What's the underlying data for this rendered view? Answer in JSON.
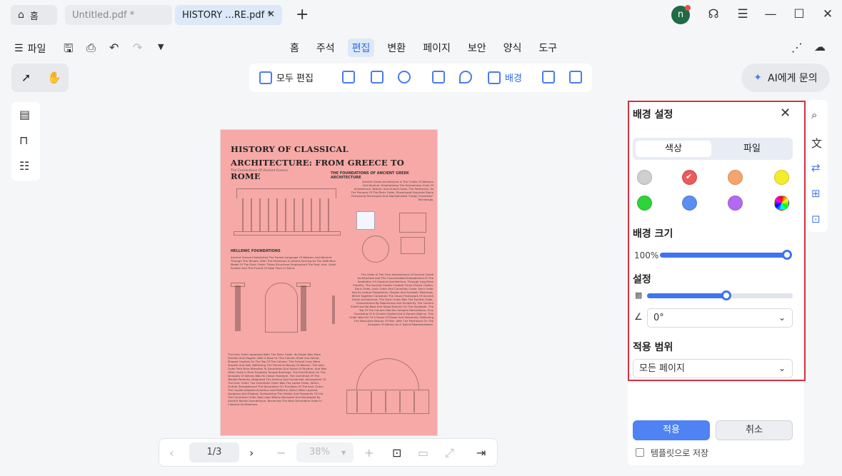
{
  "tabs": {
    "home": "홈",
    "tab1": "Untitled.pdf *",
    "tab2": "HISTORY ...RE.pdf *",
    "close": "✕",
    "new": "+"
  },
  "account": {
    "avatar_letter": "n"
  },
  "menu": {
    "file": "파일",
    "items": [
      "홈",
      "주석",
      "편집",
      "변환",
      "페이지",
      "보안",
      "양식",
      "도구"
    ],
    "active": "편집"
  },
  "toolbar": {
    "edit_all": "모두 편집",
    "background": "배경",
    "ai": "AI에게 문의"
  },
  "document": {
    "title": "HISTORY OF CLASSICAL  ARCHITECTURE: FROM GREECE TO ROME",
    "subtitle": "The Cornerstone Of Ancient Greece",
    "sec_foundations": "THE FOUNDATIONS OF ANCIENT GREEK ARCHITECTURE",
    "sec_hellenic": "HELLENIC FOUNDATIONS",
    "para1": "Ancient Greek Architecture Is The Cradle Of Western Architecture, Emphasizing The Harmonious Unity Of Architecture, Nature, And Human Gods. The Parthenon, As The Pinnacle Of The Doric Order, Showcased Exquisite Stone Processing Techniques And Sophisticated \"Visual Correction\" Technology.",
    "para2": "Ancient Greece Established The Formal Language Of Western Architecture Through The Temple, With The Parthenon In Athens Serving As The Definitive Model Of The Doric Order. These Structures Emphasized The Post- And- Lintel System And The Pursuit Of Ideal Form In Stone.",
    "para3": "The Order Is The Core Achievement Of Ancient Greek Architecture And The Concentrated Embodiment Of The Aesthetics Of Classical Architecture. Through Long-Term Practice, The Ancient Greeks Created Three Classic Orders: Doric Order, Ionic Order And Corinthian Order. Each Order Has Its Unique Proportions, Shapes And Symbolic Meanings, Which Together Constitute The Visual Framework Of Ancient Greek Architecture. The Doric Order Was The Earliest Order, Characterized By Robustness And Simplicity. The Column Shaft Had No Base And Stood Directly On The Stylobate. The Top Of The Column Had No Complex Decorations, Only Consisting Of A Circular Capital And A Square Abacus. This Order Was Full Of A Sense Of Power And Solemnity, Reflecting The Masculine Beauty Of Man. With The Parthenon On The Acropolis Of Athens As A Typical Representative.",
    "para4": "The Ionic Order Appeared After The Doric Order. Its Shape Was More Slender And Elegant, With A Base On The Column Shaft And Volute-Shaped Capitals On The Top Of The Column. The Overall Lines Were Smooth And Soft, Reflecting The Feminine Beauty Of Women. The Ionic Order Paid More Attention To Decoration And Sense Of Rhythm, And Was Often Used In More Exquisite Temple Buildings. The Erechtheion On The Acropolis Of Athens Was Its Classic Example. The Corinthian Of The Temple Perfectly Integrated The Solemn And Humanistic Atmosphere Of The Ionic Order. The Corinthian Order Was The Latest Order, Which Further Strengthened The Decoration On The Basis Of The Ionic Order. The Capital Adopted Acanthus Leaf Patterns, Which Were Layered, Gorgeous And Elegant, Symbolizing The Vitality And Prosperity Of Life. The Corinthian Order Was Later Widely Borrowed And Developed By Ancient Roman Architecture, Becoming The Most Decorative Order In Classical Architecture."
  },
  "bottombar": {
    "page": "1/3",
    "zoom": "38%"
  },
  "panel": {
    "title": "배경 설정",
    "tab_color": "색상",
    "tab_file": "파일",
    "colors": [
      "#cfcfcf",
      "#ec5a5a",
      "#f5a56b",
      "#f4ec2b",
      "#2fd33a",
      "#5b8ef2",
      "#b36af0",
      "rainbow"
    ],
    "selected_color": "#ec5a5a",
    "size_label": "배경 크기",
    "size_value": "100%",
    "size_fraction": 1.0,
    "settings_label": "설정",
    "opacity_fraction": 0.5,
    "rotation": "0°",
    "scope_label": "적용 범위",
    "scope_value": "모든 페이지",
    "apply": "적용",
    "cancel": "취소",
    "save_template": "템플릿으로 저장"
  },
  "colors": {
    "accent": "#3f74f0",
    "highlight_border": "#d62f3c",
    "page_background": "#f6a9a6"
  }
}
